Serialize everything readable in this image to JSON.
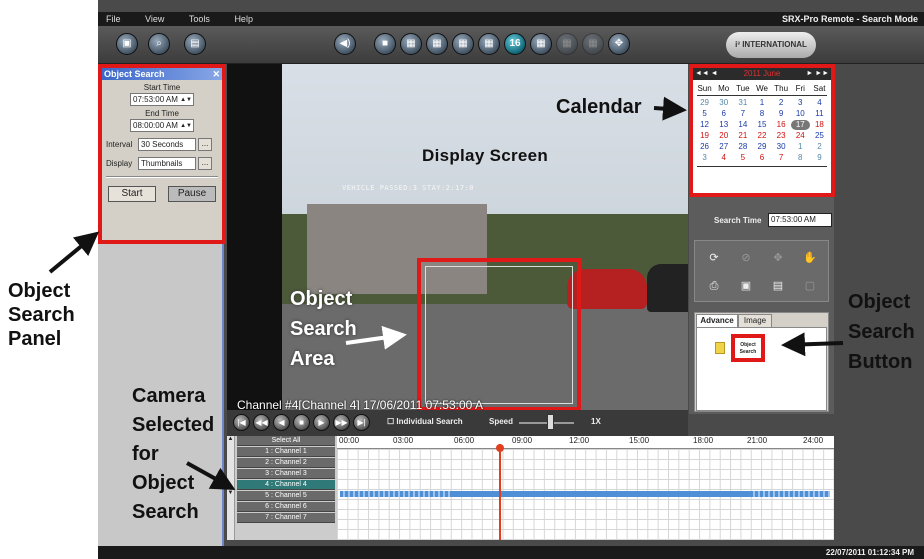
{
  "menu": {
    "items": [
      "File",
      "View",
      "Tools",
      "Help"
    ],
    "mode_title": "SRX-Pro Remote - Search Mode"
  },
  "toolbar": {
    "layout_number": "16",
    "logo_text": "i³ INTERNATIONAL"
  },
  "object_search": {
    "title": "Object Search",
    "close": "✕",
    "start_time_label": "Start Time",
    "start_time": "07:53:00 AM",
    "end_time_label": "End Time",
    "end_time": "08:00:00 AM",
    "interval_label": "Interval",
    "interval": "30 Seconds",
    "display_label": "Display",
    "display": "Thumbnails",
    "browse": "...",
    "start_button": "Start",
    "pause_button": "Pause"
  },
  "video": {
    "osd": "VEHICLE PASSED:3   STAY:2:17:0",
    "channel_caption": "Channel #4[Channel 4] 17/06/2011 07:53:00 A"
  },
  "playback": {
    "individual_search": "Individual Search",
    "speed_label": "Speed",
    "speed_value": "1X"
  },
  "calendar": {
    "month_label": "2011 June",
    "prev": "◄◄ ◄",
    "next": "► ►►",
    "weekdays": [
      "Sun",
      "Mo",
      "Tue",
      "We",
      "Thu",
      "Fri",
      "Sat"
    ],
    "days": [
      {
        "d": "29",
        "c": "gray"
      },
      {
        "d": "30",
        "c": "gray"
      },
      {
        "d": "31",
        "c": "gray"
      },
      {
        "d": "1",
        "c": "blue"
      },
      {
        "d": "2",
        "c": "blue"
      },
      {
        "d": "3",
        "c": "blue"
      },
      {
        "d": "4",
        "c": "blue"
      },
      {
        "d": "5",
        "c": "blue"
      },
      {
        "d": "6",
        "c": "blue"
      },
      {
        "d": "7",
        "c": "blue"
      },
      {
        "d": "8",
        "c": "blue"
      },
      {
        "d": "9",
        "c": "blue"
      },
      {
        "d": "10",
        "c": "blue"
      },
      {
        "d": "11",
        "c": "blue"
      },
      {
        "d": "12",
        "c": "blue"
      },
      {
        "d": "13",
        "c": "blue"
      },
      {
        "d": "14",
        "c": "blue"
      },
      {
        "d": "15",
        "c": "blue"
      },
      {
        "d": "16",
        "c": "red"
      },
      {
        "d": "17",
        "c": "sel"
      },
      {
        "d": "18",
        "c": "red"
      },
      {
        "d": "19",
        "c": "red"
      },
      {
        "d": "20",
        "c": "red"
      },
      {
        "d": "21",
        "c": "red"
      },
      {
        "d": "22",
        "c": "red"
      },
      {
        "d": "23",
        "c": "red"
      },
      {
        "d": "24",
        "c": "red"
      },
      {
        "d": "25",
        "c": "blue"
      },
      {
        "d": "26",
        "c": "blue"
      },
      {
        "d": "27",
        "c": "blue"
      },
      {
        "d": "28",
        "c": "blue"
      },
      {
        "d": "29",
        "c": "blue"
      },
      {
        "d": "30",
        "c": "blue"
      },
      {
        "d": "1",
        "c": "gray"
      },
      {
        "d": "2",
        "c": "gray"
      },
      {
        "d": "3",
        "c": "gray"
      },
      {
        "d": "4",
        "c": "red"
      },
      {
        "d": "5",
        "c": "red"
      },
      {
        "d": "6",
        "c": "red"
      },
      {
        "d": "7",
        "c": "red"
      },
      {
        "d": "8",
        "c": "gray"
      },
      {
        "d": "9",
        "c": "gray"
      }
    ]
  },
  "search_time": {
    "label": "Search Time",
    "value": "07:53:00 AM"
  },
  "advanced": {
    "tab_advance": "Advance",
    "tab_image": "Image",
    "object_search_button": "Object Search"
  },
  "timeline": {
    "select_all": "Select All",
    "channels": [
      "1 : Channel 1",
      "2 : Channel 2",
      "3 : Channel 3",
      "4 : Channel 4",
      "5 : Channel 5",
      "6 : Channel 6",
      "7 : Channel 7"
    ],
    "hours": [
      "00:00",
      "03:00",
      "06:00",
      "09:00",
      "12:00",
      "15:00",
      "18:00",
      "21:00",
      "24:00"
    ]
  },
  "status": {
    "datetime": "22/07/2011   01:12:34 PM"
  },
  "annotations": {
    "display_screen": "Display Screen",
    "calendar": "Calendar",
    "object_search_panel": [
      "Object",
      "Search",
      "Panel"
    ],
    "object_search_area": [
      "Object",
      "Search",
      "Area"
    ],
    "object_search_button": [
      "Object",
      "Search",
      "Button"
    ],
    "camera_selected": [
      "Camera",
      "Selected",
      "for",
      "Object",
      "Search"
    ]
  },
  "colors": {
    "highlight": "#e01818",
    "selected_channel": "#2f7a78",
    "recording": "#4f8fd6",
    "cursor": "#e04020"
  }
}
